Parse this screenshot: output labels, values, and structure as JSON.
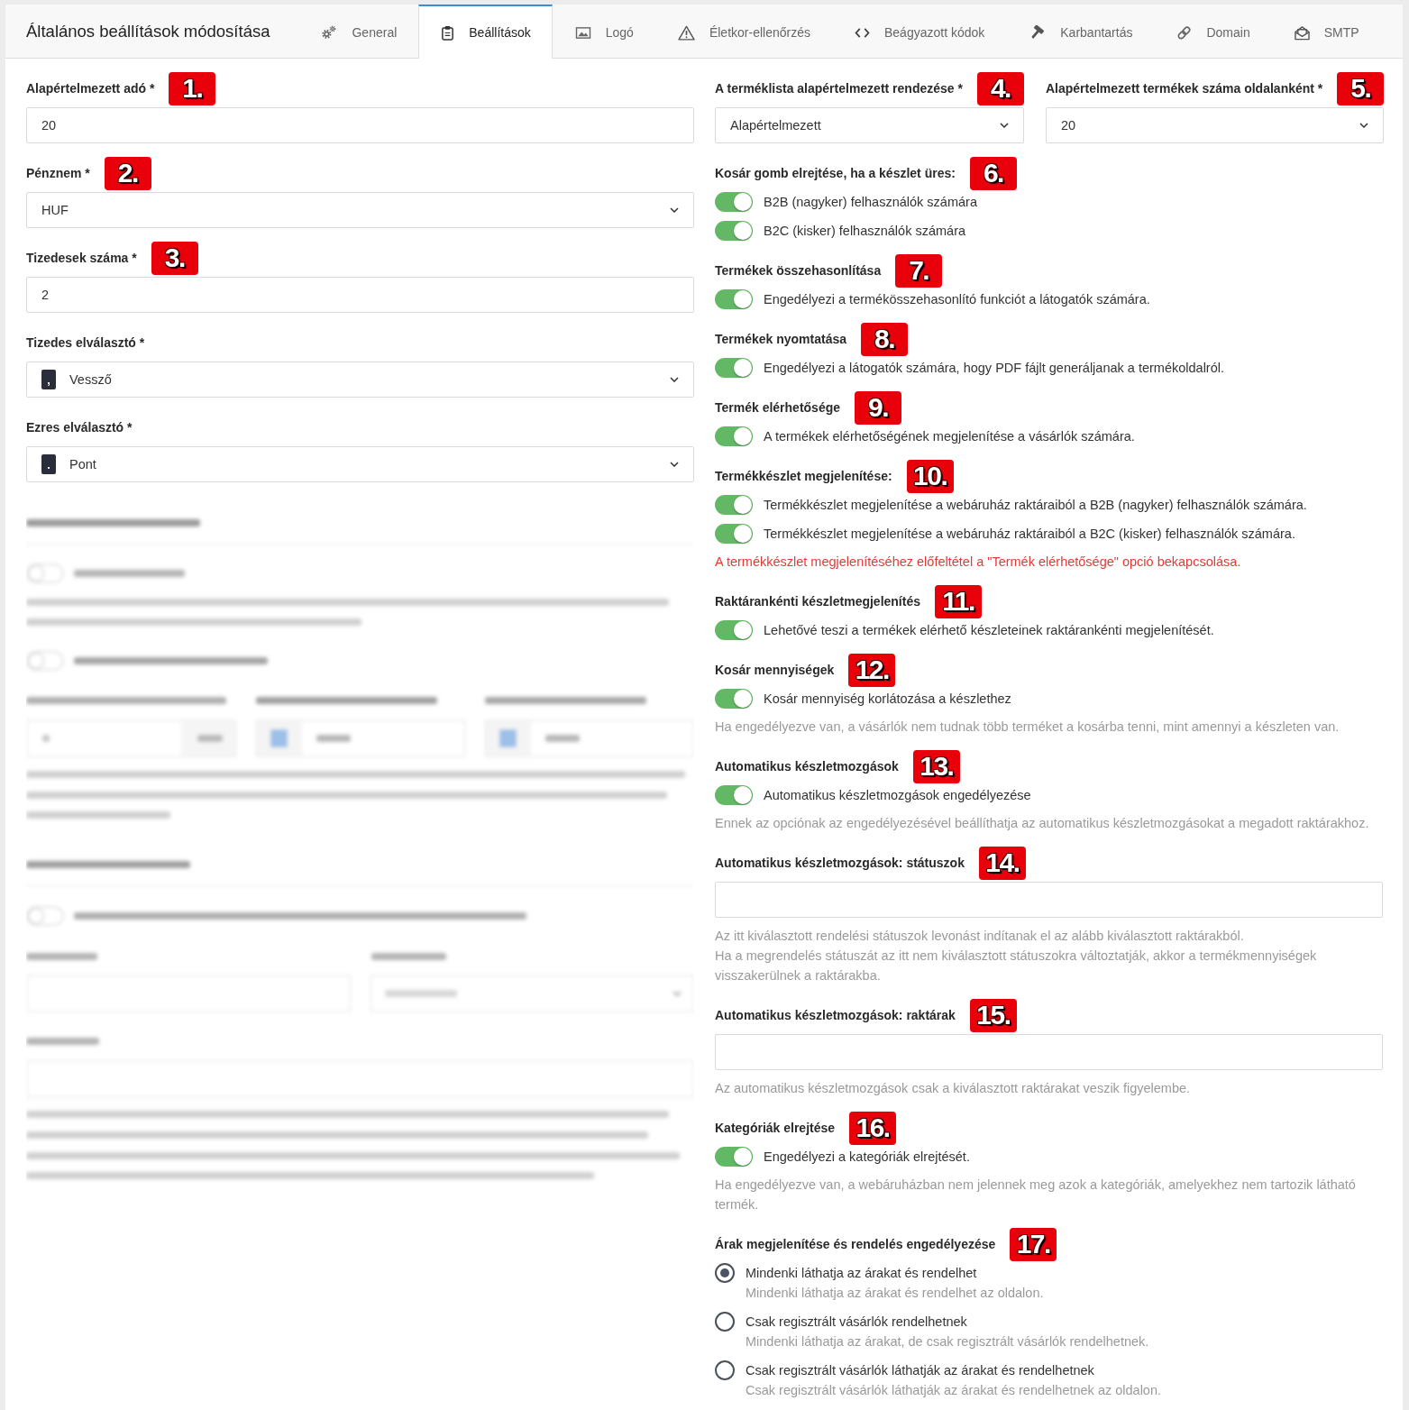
{
  "header": {
    "title": "Általános beállítások módosítása",
    "tabs": [
      {
        "label": "General",
        "selected": false
      },
      {
        "label": "Beállítások",
        "selected": true
      },
      {
        "label": "Logó",
        "selected": false
      },
      {
        "label": "Életkor-ellenőrzés",
        "selected": false
      },
      {
        "label": "Beágyazott kódok",
        "selected": false
      },
      {
        "label": "Karbantartás",
        "selected": false
      },
      {
        "label": "Domain",
        "selected": false
      },
      {
        "label": "SMTP",
        "selected": false
      }
    ]
  },
  "general_fields": [
    {
      "kind": "input",
      "label": "Alapértelmezett adó *",
      "marker": "1.",
      "value": "20"
    },
    {
      "kind": "select",
      "label": "Pénznem *",
      "marker": "2.",
      "value": "HUF"
    },
    {
      "kind": "input",
      "label": "Tizedesek száma *",
      "marker": "3.",
      "value": "2"
    },
    {
      "kind": "select",
      "label": "Tizedes elválasztó *",
      "symbol": ",",
      "value": "Vessző"
    },
    {
      "kind": "select",
      "label": "Ezres elválasztó *",
      "symbol": ".",
      "value": "Pont"
    }
  ],
  "listing_fields": [
    {
      "kind": "select",
      "label": "A terméklista alapértelmezett rendezése *",
      "marker": "4.",
      "value": "Alapértelmezett"
    },
    {
      "kind": "select",
      "label": "Alapértelmezett termékek száma oldalanként *",
      "marker": "5.",
      "value": "20"
    }
  ],
  "settings": [
    {
      "kind": "toggles",
      "title": "Kosár gomb elrejtése, ha a készlet üres:",
      "marker": "6.",
      "toggles": [
        {
          "label": "B2B (nagyker) felhasználók számára",
          "on": true
        },
        {
          "label": "B2C (kisker) felhasználók számára",
          "on": true
        }
      ]
    },
    {
      "kind": "toggles",
      "title": "Termékek összehasonlítása",
      "marker": "7.",
      "toggles": [
        {
          "label": "Engedélyezi a termékösszehasonlító funkciót a látogatók számára.",
          "on": true
        }
      ]
    },
    {
      "kind": "toggles",
      "title": "Termékek nyomtatása",
      "marker": "8.",
      "toggles": [
        {
          "label": "Engedélyezi a látogatók számára, hogy PDF fájlt generáljanak a termékoldalról.",
          "on": true
        }
      ]
    },
    {
      "kind": "toggles",
      "title": "Termék elérhetősége",
      "marker": "9.",
      "toggles": [
        {
          "label": "A termékek elérhetőségének megjelenítése a vásárlók számára.",
          "on": true
        }
      ]
    },
    {
      "kind": "toggles",
      "title": "Termékkészlet megjelenítése:",
      "marker": "10.",
      "toggles": [
        {
          "label": "Termékkészlet megjelenítése a webáruház raktáraiból a B2B (nagyker) felhasználók számára.",
          "on": true
        },
        {
          "label": "Termékkészlet megjelenítése a webáruház raktáraiból a B2C (kisker) felhasználók számára.",
          "on": true
        }
      ],
      "warning": "A termékkészlet megjelenítéséhez előfeltétel a \"Termék elérhetősége\" opció bekapcsolása."
    },
    {
      "kind": "toggles",
      "title": "Raktárankénti készletmegjelenítés",
      "marker": "11.",
      "toggles": [
        {
          "label": "Lehetővé teszi a termékek elérhető készleteinek raktárankénti megjelenítését.",
          "on": true
        }
      ]
    },
    {
      "kind": "toggles",
      "title": "Kosár mennyiségek",
      "marker": "12.",
      "toggles": [
        {
          "label": "Kosár mennyiség korlátozása a készlethez",
          "on": true
        }
      ],
      "help": [
        "Ha engedélyezve van, a vásárlók nem tudnak több terméket a kosárba tenni, mint amennyi a készleten van."
      ]
    },
    {
      "kind": "toggles",
      "title": "Automatikus készletmozgások",
      "marker": "13.",
      "toggles": [
        {
          "label": "Automatikus készletmozgások engedélyezése",
          "on": true
        }
      ],
      "help": [
        "Ennek az opciónak az engedélyezésével beállíthatja az automatikus készletmozgásokat a megadott raktárakhoz."
      ]
    },
    {
      "kind": "field",
      "title": "Automatikus készletmozgások: státuszok",
      "marker": "14.",
      "help": [
        "Az itt kiválasztott rendelési státuszok levonást indítanak el az alább kiválasztott raktárakból.",
        "Ha a megrendelés státuszát az itt nem kiválasztott státuszokra változtatják, akkor a termékmennyiségek visszakerülnek a raktárakba."
      ]
    },
    {
      "kind": "field",
      "title": "Automatikus készletmozgások: raktárak",
      "marker": "15.",
      "help": [
        "Az automatikus készletmozgások csak a kiválasztott raktárakat veszik figyelembe."
      ]
    },
    {
      "kind": "toggles",
      "title": "Kategóriák elrejtése",
      "marker": "16.",
      "toggles": [
        {
          "label": "Engedélyezi a kategóriák elrejtését.",
          "on": true
        }
      ],
      "help": [
        "Ha engedélyezve van, a webáruházban nem jelennek meg azok a kategóriák, amelyekhez nem tartozik látható termék."
      ]
    },
    {
      "kind": "radios",
      "title": "Árak megjelenítése és rendelés engedélyezése",
      "marker": "17.",
      "options": [
        {
          "label": "Mindenki láthatja az árakat és rendelhet",
          "description": "Mindenki láthatja az árakat és rendelhet az oldalon.",
          "selected": true
        },
        {
          "label": "Csak regisztrált vásárlók rendelhetnek",
          "description": "Mindenki láthatja az árakat, de csak regisztrált vásárlók rendelhetnek.",
          "selected": false
        },
        {
          "label": "Csak regisztrált vásárlók láthatják az árakat és rendelhetnek",
          "description": "Csak regisztrált vásárlók láthatják az árakat és rendelhetnek az oldalon.",
          "selected": false
        }
      ]
    }
  ]
}
